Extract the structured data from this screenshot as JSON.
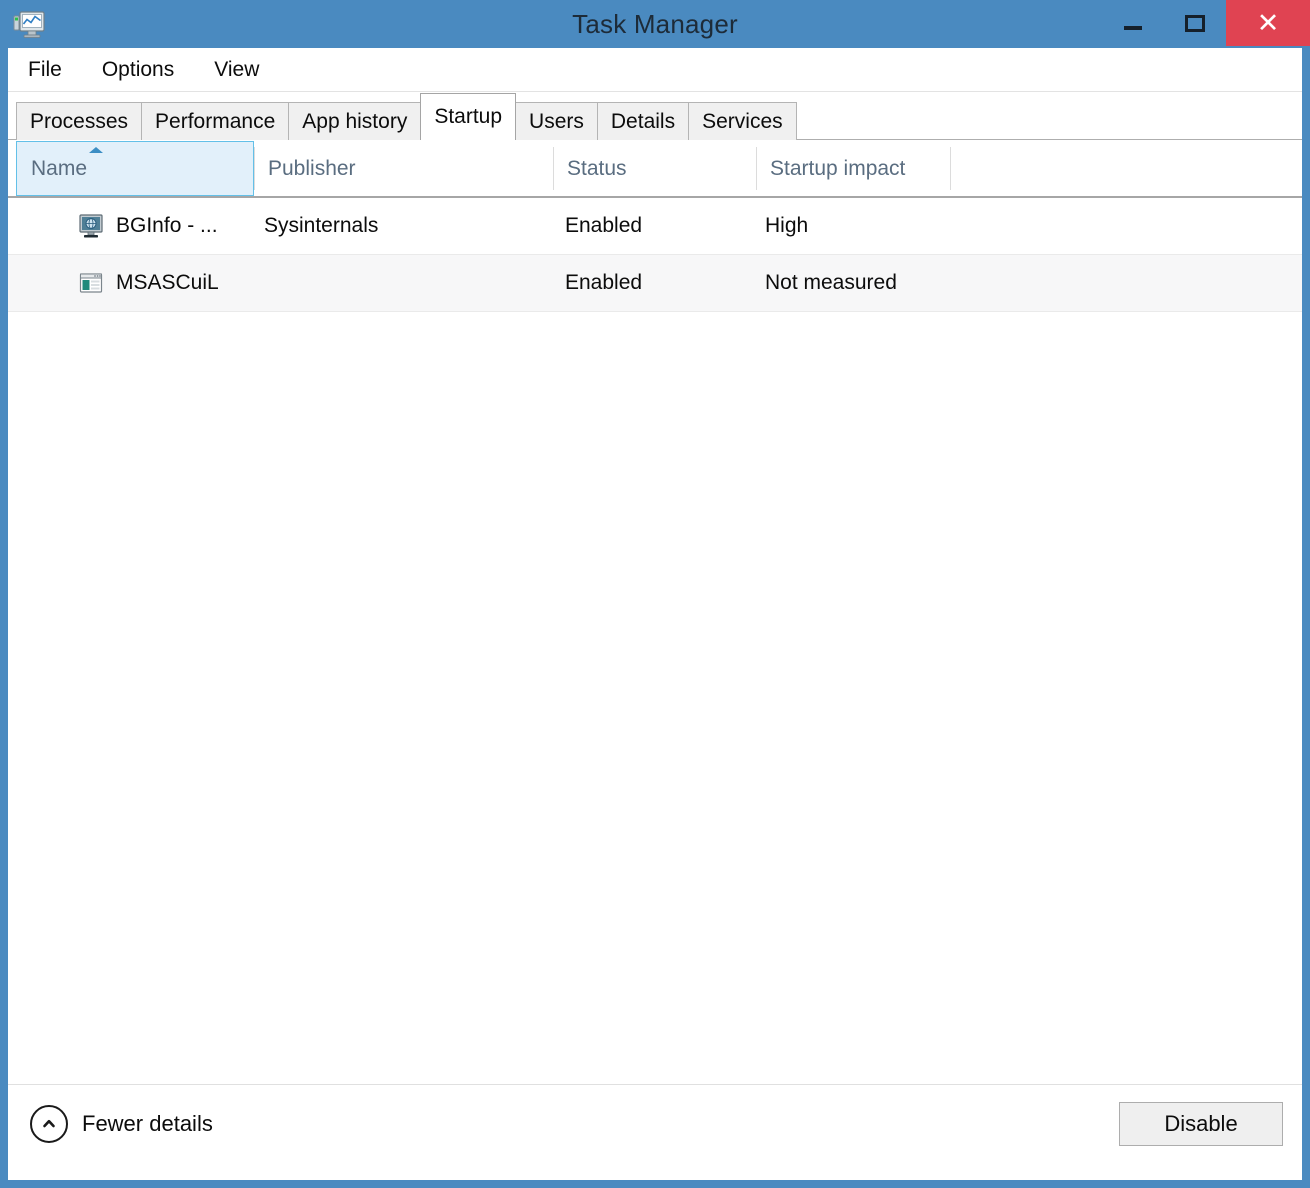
{
  "window": {
    "title": "Task Manager",
    "app_icon": "task-manager-monitor-icon",
    "accent_color": "#4a8ac0",
    "close_color": "#e04352",
    "controls": {
      "minimize": "minimize-icon",
      "maximize": "maximize-icon",
      "close": "✕"
    }
  },
  "menu": {
    "items": [
      {
        "label": "File"
      },
      {
        "label": "Options"
      },
      {
        "label": "View"
      }
    ]
  },
  "tabs": [
    {
      "label": "Processes",
      "active": false
    },
    {
      "label": "Performance",
      "active": false
    },
    {
      "label": "App history",
      "active": false
    },
    {
      "label": "Startup",
      "active": true
    },
    {
      "label": "Users",
      "active": false
    },
    {
      "label": "Details",
      "active": false
    },
    {
      "label": "Services",
      "active": false
    }
  ],
  "table": {
    "columns": [
      {
        "label": "Name",
        "sorted": true,
        "sort_direction": "ascending"
      },
      {
        "label": "Publisher",
        "sorted": false
      },
      {
        "label": "Status",
        "sorted": false
      },
      {
        "label": "Startup impact",
        "sorted": false
      }
    ],
    "rows": [
      {
        "icon": "bginfo-monitor-globe-icon",
        "name": "BGInfo - ...",
        "publisher": "Sysinternals",
        "status": "Enabled",
        "impact": "High"
      },
      {
        "icon": "msascuil-window-icon",
        "name": "MSASCuiL",
        "publisher": "",
        "status": "Enabled",
        "impact": "Not measured"
      }
    ]
  },
  "footer": {
    "fewer_details_label": "Fewer details",
    "fewer_details_icon": "circle-chevron-up-icon",
    "disable_label": "Disable"
  }
}
